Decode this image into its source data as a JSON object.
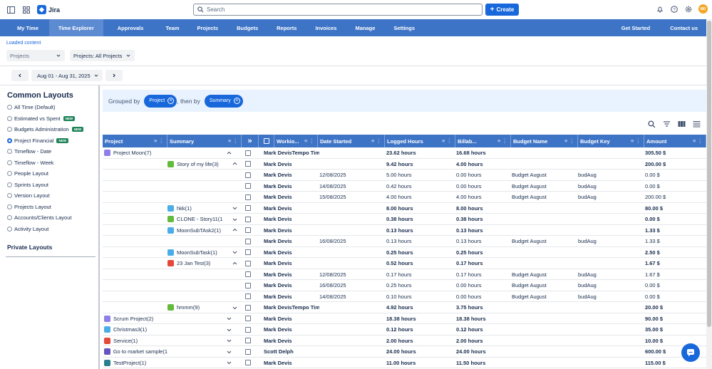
{
  "app": {
    "name": "Jira"
  },
  "search": {
    "placeholder": "Search"
  },
  "create_label": "Create",
  "user_initials": "MD",
  "nav": {
    "items": [
      "My Time",
      "Time Explorer",
      "Approvals",
      "Team",
      "Projects",
      "Budgets",
      "Reports",
      "Invoices",
      "Manage",
      "Settings"
    ],
    "active": "Time Explorer",
    "right": [
      "Get Started",
      "Contact us"
    ]
  },
  "loaded_content": "Loaded content",
  "filters": {
    "projects": "Projects",
    "projects_scope": "Projects: All Projects"
  },
  "date_range": "Aug 01 - Aug 31, 2025",
  "sidebar": {
    "title": "Common Layouts",
    "items": [
      {
        "label": "All Time (Default)",
        "new": false,
        "selected": false
      },
      {
        "label": "Estimated vs Spent",
        "new": true,
        "selected": false
      },
      {
        "label": "Budgets Administration",
        "new": true,
        "selected": false
      },
      {
        "label": "Project Financial",
        "new": true,
        "selected": true
      },
      {
        "label": "Timeflow - Date",
        "new": false,
        "selected": false
      },
      {
        "label": "Timeflow - Week",
        "new": false,
        "selected": false
      },
      {
        "label": "People Layout",
        "new": false,
        "selected": false
      },
      {
        "label": "Sprints Layout",
        "new": false,
        "selected": false
      },
      {
        "label": "Version Layout",
        "new": false,
        "selected": false
      },
      {
        "label": "Projects Layout",
        "new": false,
        "selected": false
      },
      {
        "label": "Accounts/Clients Layout",
        "new": false,
        "selected": false
      },
      {
        "label": "Activity Layout",
        "new": false,
        "selected": false
      }
    ],
    "new_badge": "NEW",
    "private_title": "Private Layouts"
  },
  "grouping": {
    "grouped_by": "Grouped by",
    "first": "Project",
    "then_by": ", then by",
    "second": "Summary"
  },
  "table": {
    "columns": [
      "Project",
      "Summary",
      "Workio...",
      "Date Started",
      "Logged Hours",
      "Billab...",
      "Budget Name",
      "Budget Key",
      "Amount"
    ],
    "rows": [
      {
        "lvl": 0,
        "icon": "project-icon",
        "color": "#8f7ee7",
        "project": "Project Moon(7)",
        "summary": "",
        "worker": "Mark DevisTempo Tim",
        "date": "",
        "logged": "23.62 hours",
        "billable": "16.68 hours",
        "bname": "",
        "bkey": "",
        "amount": "305.50 $",
        "bold": true,
        "chev": "up"
      },
      {
        "lvl": 1,
        "icon": "story-icon",
        "color": "#63ba3c",
        "project": "",
        "summary": "Story of my life(3)",
        "worker": "Mark Devis",
        "date": "",
        "logged": "9.42 hours",
        "billable": "4.00 hours",
        "bname": "",
        "bkey": "",
        "amount": "200.00 $",
        "bold": true,
        "chev": "up"
      },
      {
        "lvl": 2,
        "icon": "",
        "color": "",
        "project": "",
        "summary": "",
        "worker": "Mark Devis",
        "date": "12/08/2025",
        "logged": "5.00 hours",
        "billable": "0.00 hours",
        "bname": "Budget August",
        "bkey": "budAug",
        "amount": "0.00 $",
        "bold": false,
        "chev": ""
      },
      {
        "lvl": 2,
        "icon": "",
        "color": "",
        "project": "",
        "summary": "",
        "worker": "Mark Devis",
        "date": "14/08/2025",
        "logged": "0.42 hours",
        "billable": "0.00 hours",
        "bname": "Budget August",
        "bkey": "budAug",
        "amount": "0.00 $",
        "bold": false,
        "chev": ""
      },
      {
        "lvl": 2,
        "icon": "",
        "color": "",
        "project": "",
        "summary": "",
        "worker": "Mark Devis",
        "date": "15/08/2025",
        "logged": "4.00 hours",
        "billable": "4.00 hours",
        "bname": "Budget August",
        "bkey": "budAug",
        "amount": "200.00 $",
        "bold": false,
        "chev": ""
      },
      {
        "lvl": 1,
        "icon": "task-icon",
        "color": "#4bade8",
        "project": "",
        "summary": "hkk(1)",
        "worker": "Mark Devis",
        "date": "",
        "logged": "8.00 hours",
        "billable": "8.00 hours",
        "bname": "",
        "bkey": "",
        "amount": "80.00 $",
        "bold": true,
        "chev": "down"
      },
      {
        "lvl": 1,
        "icon": "story-icon",
        "color": "#63ba3c",
        "project": "",
        "summary": "CLONE - Story11(1",
        "worker": "Mark Devis",
        "date": "",
        "logged": "0.38 hours",
        "billable": "0.38 hours",
        "bname": "",
        "bkey": "",
        "amount": "0.00 $",
        "bold": true,
        "chev": "down"
      },
      {
        "lvl": 1,
        "icon": "subtask-icon",
        "color": "#4bade8",
        "project": "",
        "summary": "MoonSubTAsk2(1)",
        "worker": "Mark Devis",
        "date": "",
        "logged": "0.13 hours",
        "billable": "0.13 hours",
        "bname": "",
        "bkey": "",
        "amount": "1.33 $",
        "bold": true,
        "chev": "up"
      },
      {
        "lvl": 2,
        "icon": "",
        "color": "",
        "project": "",
        "summary": "",
        "worker": "Mark Devis",
        "date": "16/08/2025",
        "logged": "0.13 hours",
        "billable": "0.13 hours",
        "bname": "Budget August",
        "bkey": "budAug",
        "amount": "1.33 $",
        "bold": false,
        "chev": ""
      },
      {
        "lvl": 1,
        "icon": "subtask-icon",
        "color": "#4bade8",
        "project": "",
        "summary": "MoonSubTask(1)",
        "worker": "Mark Devis",
        "date": "",
        "logged": "0.25 hours",
        "billable": "0.25 hours",
        "bname": "",
        "bkey": "",
        "amount": "2.50 $",
        "bold": true,
        "chev": "down"
      },
      {
        "lvl": 1,
        "icon": "bug-icon",
        "color": "#e5493a",
        "project": "",
        "summary": "23 Jan Test(3)",
        "worker": "Mark Devis",
        "date": "",
        "logged": "0.52 hours",
        "billable": "0.17 hours",
        "bname": "",
        "bkey": "",
        "amount": "1.67 $",
        "bold": true,
        "chev": "up"
      },
      {
        "lvl": 2,
        "icon": "",
        "color": "",
        "project": "",
        "summary": "",
        "worker": "Mark Devis",
        "date": "12/08/2025",
        "logged": "0.17 hours",
        "billable": "0.17 hours",
        "bname": "Budget August",
        "bkey": "budAug",
        "amount": "1.67 $",
        "bold": false,
        "chev": ""
      },
      {
        "lvl": 2,
        "icon": "",
        "color": "",
        "project": "",
        "summary": "",
        "worker": "Mark Devis",
        "date": "16/08/2025",
        "logged": "0.25 hours",
        "billable": "0.00 hours",
        "bname": "Budget August",
        "bkey": "budAug",
        "amount": "0.00 $",
        "bold": false,
        "chev": ""
      },
      {
        "lvl": 2,
        "icon": "",
        "color": "",
        "project": "",
        "summary": "",
        "worker": "Mark Devis",
        "date": "14/08/2025",
        "logged": "0.10 hours",
        "billable": "0.00 hours",
        "bname": "Budget August",
        "bkey": "budAug",
        "amount": "0.00 $",
        "bold": false,
        "chev": ""
      },
      {
        "lvl": 1,
        "icon": "story-icon",
        "color": "#63ba3c",
        "project": "",
        "summary": "hmmm(9)",
        "worker": "Mark DevisTempo Tim",
        "date": "",
        "logged": "4.92 hours",
        "billable": "3.75 hours",
        "bname": "",
        "bkey": "",
        "amount": "20.00 $",
        "bold": true,
        "chev": "down"
      },
      {
        "lvl": 0,
        "icon": "project-icon",
        "color": "#8f7ee7",
        "project": "Scrum Project(2)",
        "summary": "",
        "worker": "Mark Devis",
        "date": "",
        "logged": "18.38 hours",
        "billable": "18.38 hours",
        "bname": "",
        "bkey": "",
        "amount": "90.00 $",
        "bold": true,
        "chev": "down"
      },
      {
        "lvl": 0,
        "icon": "project-icon",
        "color": "#4bade8",
        "project": "Christmas3(1)",
        "summary": "",
        "worker": "Mark Devis",
        "date": "",
        "logged": "0.12 hours",
        "billable": "0.12 hours",
        "bname": "",
        "bkey": "",
        "amount": "35.00 $",
        "bold": true,
        "chev": "down"
      },
      {
        "lvl": 0,
        "icon": "project-icon",
        "color": "#e5493a",
        "project": "Service(1)",
        "summary": "",
        "worker": "Mark Devis",
        "date": "",
        "logged": "2.00 hours",
        "billable": "2.00 hours",
        "bname": "",
        "bkey": "",
        "amount": "10.00 $",
        "bold": true,
        "chev": "down"
      },
      {
        "lvl": 0,
        "icon": "project-icon",
        "color": "#6554c0",
        "project": "Go to market sample(1",
        "summary": "",
        "worker": "Scott Delph",
        "date": "",
        "logged": "24.00 hours",
        "billable": "24.00 hours",
        "bname": "",
        "bkey": "",
        "amount": "600.00 $",
        "bold": true,
        "chev": "down"
      },
      {
        "lvl": 0,
        "icon": "project-icon",
        "color": "#2a7f8f",
        "project": "TestProject(1)",
        "summary": "",
        "worker": "Mark Devis",
        "date": "",
        "logged": "11.00 hours",
        "billable": "11.50 hours",
        "bname": "",
        "bkey": "",
        "amount": "115.00 $",
        "bold": true,
        "chev": "down"
      }
    ]
  }
}
